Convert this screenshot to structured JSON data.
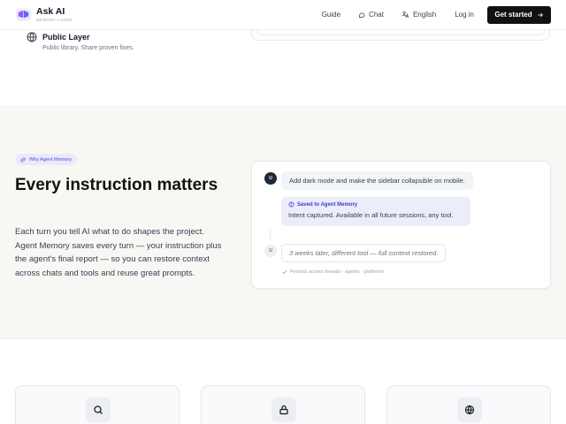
{
  "header": {
    "logo_title": "Ask AI",
    "logo_subtitle": "MEMORY LAYER",
    "nav": {
      "guide": "Guide",
      "chat": "Chat",
      "language": "English",
      "login": "Log in",
      "cta": "Get started"
    }
  },
  "public_layer": {
    "title": "Public Layer",
    "description": "Public library. Share proven fixes."
  },
  "why": {
    "badge": "Why Agent Memory",
    "title": "Every instruction matters",
    "body": "Each turn you tell AI what to do shapes the project. Agent Memory saves every turn — your instruction plus the agent's final report — so you can restore context across chats and tools and reuse great prompts."
  },
  "chat_card": {
    "avatar_user": "U",
    "avatar_later": "U",
    "user_message": "Add dark mode and make the sidebar collapsible on mobile.",
    "saved_title": "Saved to Agent Memory",
    "saved_body": "Intent captured. Available in all future sessions, any tool.",
    "later_message": "3 weeks later, different tool — full context restored.",
    "persist_note": "Persists across threads · agents · platforms"
  },
  "features": [
    {
      "icon": "search-icon"
    },
    {
      "icon": "lock-icon"
    },
    {
      "icon": "globe-icon"
    }
  ],
  "colors": {
    "accent": "#4f46e5",
    "cta_bg": "#111111",
    "section_bg": "#f8f7f3",
    "saved_bg": "#ebedfb",
    "check_green": "#22c55e"
  }
}
